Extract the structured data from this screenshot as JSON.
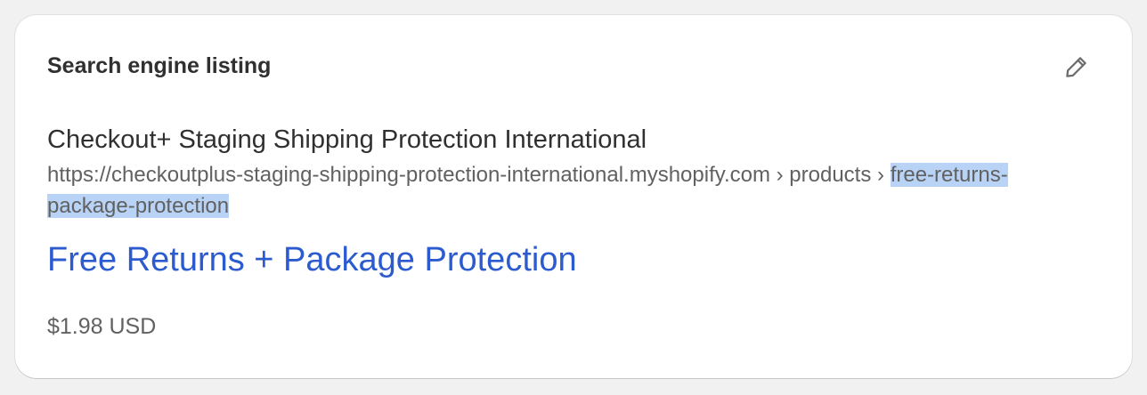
{
  "card": {
    "title": "Search engine listing",
    "edit_icon": "pencil-icon"
  },
  "preview": {
    "store_name": "Checkout+ Staging Shipping Protection International",
    "url_base": "https://checkoutplus-staging-shipping-protection-international.myshopify.com › products › ",
    "url_handle": "free-returns-package-protection",
    "page_title": "Free Returns + Package Protection",
    "price": "$1.98 USD"
  },
  "colors": {
    "link": "#2c5bd0",
    "selection_highlight": "#b8d3f5",
    "text_primary": "#303030",
    "text_secondary": "#616161"
  }
}
